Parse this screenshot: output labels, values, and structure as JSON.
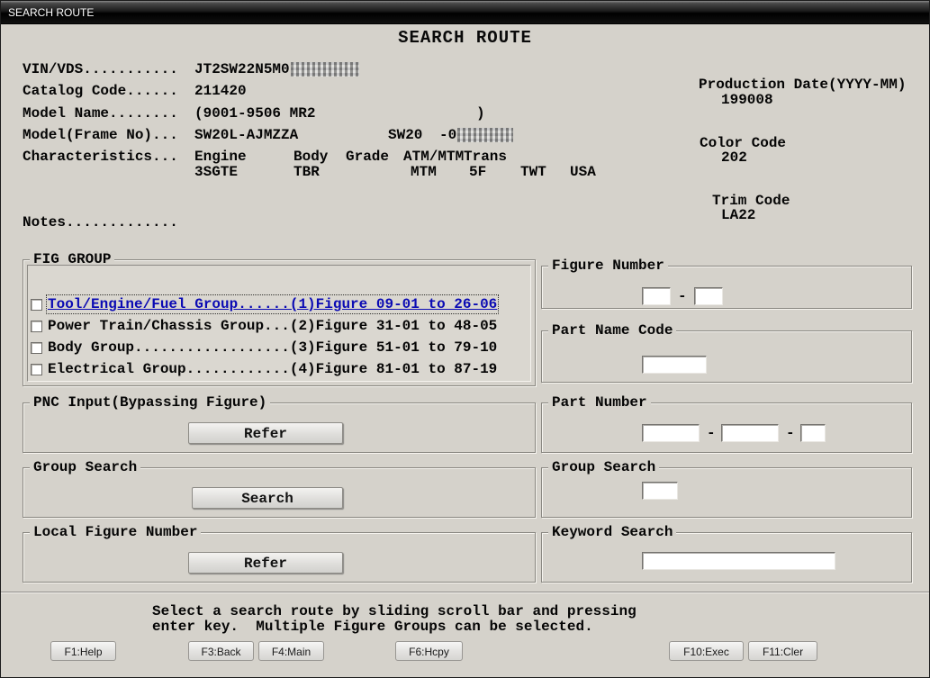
{
  "window": {
    "title": "SEARCH ROUTE"
  },
  "header": {
    "title": "SEARCH ROUTE"
  },
  "info": {
    "vin_label": "VIN/VDS...........",
    "vin_value": "JT2SW22N5M0",
    "catalog_label": "Catalog Code......",
    "catalog_value": "211420",
    "model_name_label": "Model Name........",
    "model_name_value": "(9001-9506 MR2",
    "model_name_close": ")",
    "frame_label": "Model(Frame No)...",
    "frame_code": "SW20L-AJMZZA",
    "frame_model": "SW20",
    "frame_suffix": "-0",
    "characteristics_label": "Characteristics...",
    "char_headers": [
      "Engine",
      "Body",
      "Grade",
      "ATM/MTM",
      "Trans"
    ],
    "char_values": [
      "3SGTE",
      "TBR",
      "MTM",
      "5F",
      "TWT",
      "USA"
    ],
    "notes_label": "Notes.............",
    "production_label": "Production Date(YYYY-MM)",
    "production_value": "199008",
    "color_label": "Color Code",
    "color_value": "202",
    "trim_label": "Trim Code",
    "trim_value": "LA22"
  },
  "fig_group": {
    "legend": "FIG GROUP",
    "items": [
      {
        "label": "Tool/Engine/Fuel Group......(1)Figure 09-01 to 26-06",
        "checked": false,
        "focused": true
      },
      {
        "label": "Power Train/Chassis Group...(2)Figure 31-01 to 48-05",
        "checked": false,
        "focused": false
      },
      {
        "label": "Body Group..................(3)Figure 51-01 to 79-10",
        "checked": false,
        "focused": false
      },
      {
        "label": "Electrical Group............(4)Figure 81-01 to 87-19",
        "checked": false,
        "focused": false
      }
    ]
  },
  "panels": {
    "figure_number": {
      "legend": "Figure Number",
      "separator": "-"
    },
    "part_name_code": {
      "legend": "Part Name Code"
    },
    "part_number": {
      "legend": "Part Number",
      "separator": "-"
    },
    "group_search_input": {
      "legend": "Group Search"
    },
    "keyword_search": {
      "legend": "Keyword Search"
    },
    "pnc_input": {
      "legend": "PNC Input(Bypassing Figure)",
      "button_label": "Refer"
    },
    "group_search": {
      "legend": "Group Search",
      "button_label": "Search"
    },
    "local_figure_number": {
      "legend": "Local Figure Number",
      "button_label": "Refer"
    }
  },
  "footer": {
    "instruction_line1": "Select a search route by sliding scroll bar and pressing",
    "instruction_line2": "enter key.  Multiple Figure Groups can be selected.",
    "buttons": [
      "F1:Help",
      "F3:Back",
      "F4:Main",
      "F6:Hcpy",
      "F10:Exec",
      "F11:Cler"
    ]
  }
}
